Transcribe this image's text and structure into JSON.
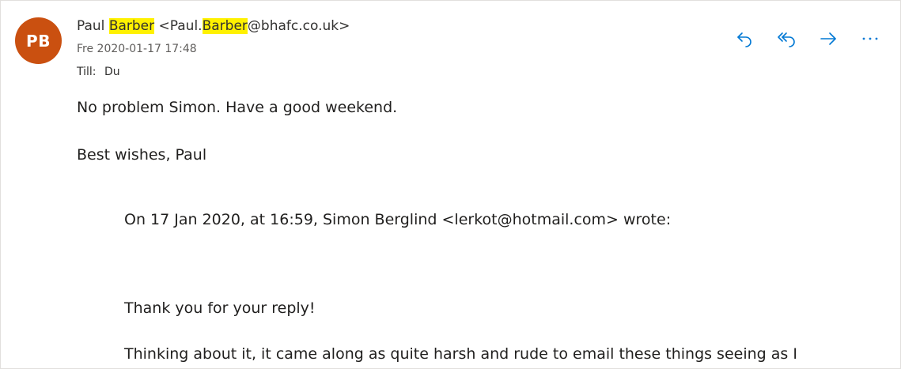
{
  "message": {
    "avatar_initials": "PB",
    "sender": {
      "first_name": "Paul",
      "last_name": "Barber",
      "email_open": "<Paul.",
      "email_last": "Barber",
      "email_domain": "@bhafc.co.uk>"
    },
    "date": "Fre 2020-01-17 17:48",
    "to_label": "Till:",
    "to_value": "Du",
    "body": {
      "line1": "No problem Simon. Have a good weekend.",
      "line2": "Best wishes, Paul"
    },
    "quoted": {
      "header": "On 17 Jan 2020, at 16:59, Simon Berglind <lerkot@hotmail.com> wrote:",
      "line1": "Thank you for your reply!",
      "line2": "Thinking about it, it came along as quite harsh and rude to email these things seeing as I"
    }
  },
  "actions": [
    {
      "name": "reply",
      "icon": "reply-icon"
    },
    {
      "name": "reply-all",
      "icon": "reply-all-icon"
    },
    {
      "name": "forward",
      "icon": "forward-icon"
    },
    {
      "name": "more",
      "icon": "more-icon"
    }
  ],
  "colors": {
    "avatar": "#ca5010",
    "highlight": "#fff100",
    "action_icon": "#0078d4"
  }
}
